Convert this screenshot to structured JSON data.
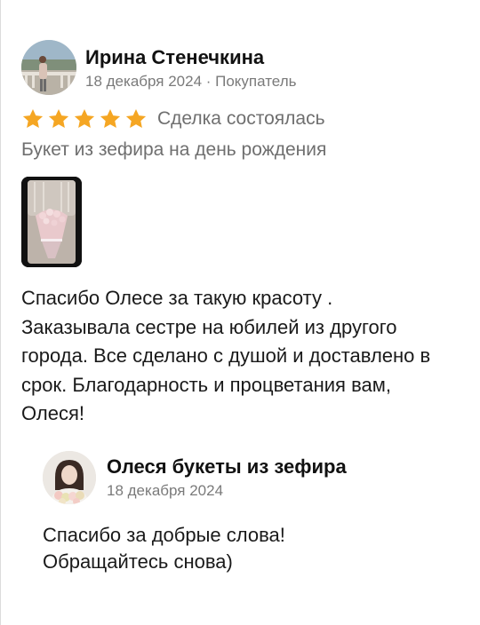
{
  "review": {
    "author_name": "Ирина Стенечкина",
    "meta": "18 декабря 2024 · Покупатель",
    "rating": 5,
    "rating_max": 5,
    "deal_status": "Сделка состоялась",
    "subject": "Букет из зефира на день рождения",
    "photo_icon": "bouquet-photo",
    "text_lines": [
      "Спасибо Олесе за такую красоту .",
      "Заказывала сестре на юбилей из другого",
      "города. Все сделано с душой и доставлено в",
      "срок. Благодарность и процветания вам,",
      "Олеся!"
    ]
  },
  "reply": {
    "author_name": "Олеся букеты из зефира",
    "date": "18 декабря 2024",
    "text_lines": [
      "Спасибо за добрые слова!",
      "Обращайтесь снова)"
    ]
  },
  "colors": {
    "star": "#f5a623",
    "muted_text": "#7a7a7a",
    "main_text": "#1a1a1a"
  }
}
